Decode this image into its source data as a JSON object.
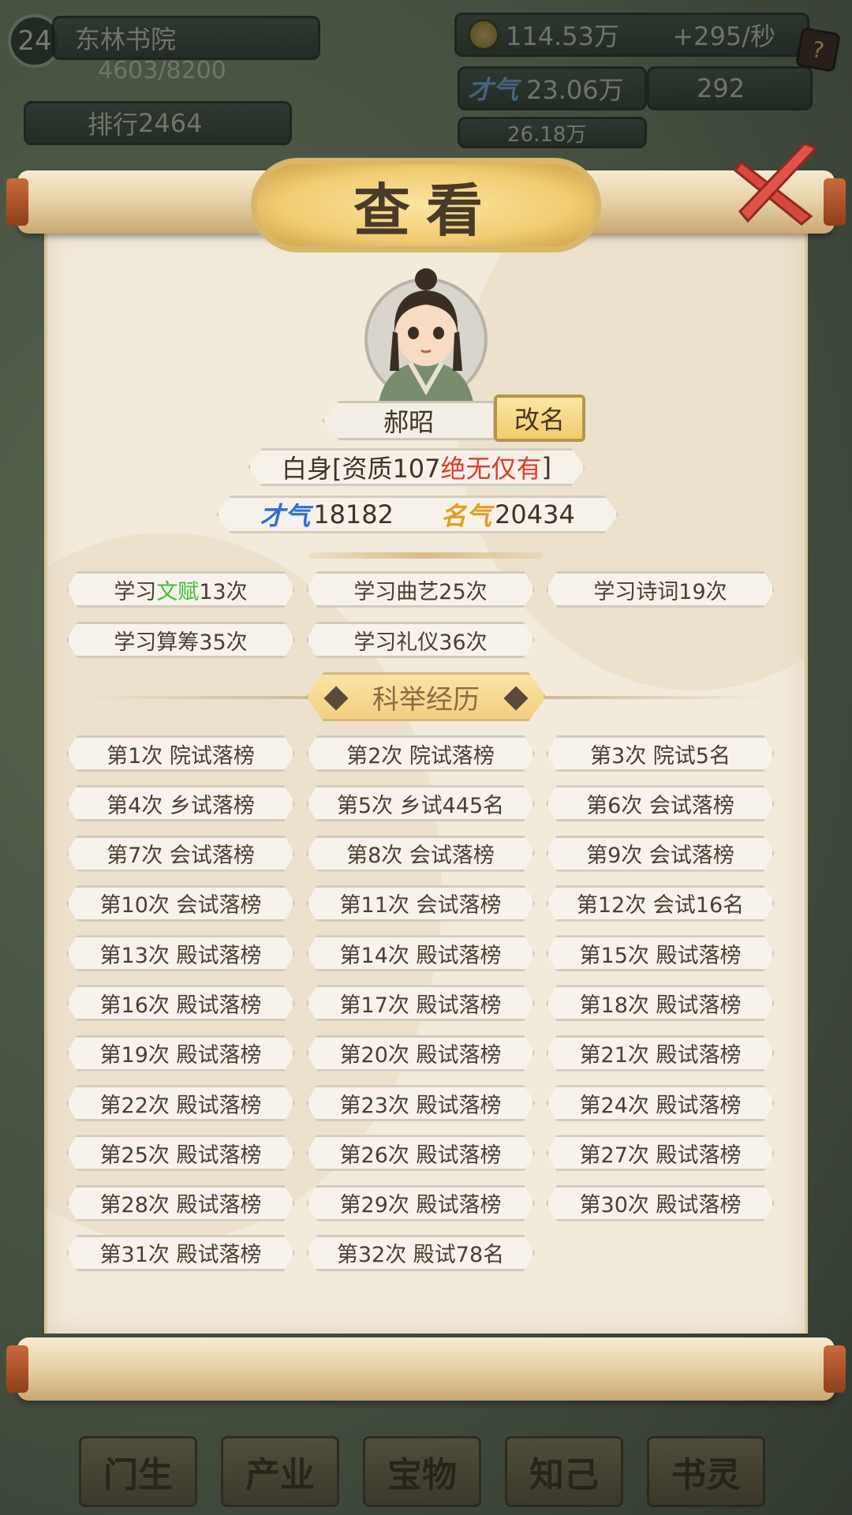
{
  "hud": {
    "level": "24",
    "school_name": "东林书院",
    "progress_text": "4603/8200",
    "rank_label": "排行",
    "rank_value": "2464",
    "coins": "114.53万",
    "coin_rate": "+295/秒",
    "talent_label": "才气",
    "talent_total": "23.06万",
    "item_count": "292",
    "fame_partial": "26.18万",
    "bottom_tabs": [
      "门生",
      "产业",
      "宝物",
      "知己",
      "书灵"
    ]
  },
  "dialog": {
    "title": "查看",
    "name": "郝昭",
    "rename_label": "改名",
    "status_prefix": "白身[资质107 ",
    "status_quality": "绝无仅有",
    "status_suffix": "]",
    "talent_label": "才气",
    "talent_value": "18182",
    "fame_label": "名气",
    "fame_value": "20434",
    "studies": [
      {
        "pre": "学习",
        "hl": "文赋",
        "post": "13次"
      },
      {
        "pre": "学习曲艺25次",
        "hl": "",
        "post": ""
      },
      {
        "pre": "学习诗词19次",
        "hl": "",
        "post": ""
      },
      {
        "pre": "学习算筹35次",
        "hl": "",
        "post": ""
      },
      {
        "pre": "学习礼仪36次",
        "hl": "",
        "post": ""
      }
    ],
    "exam_header": "科举经历",
    "exams": [
      "第1次 院试落榜",
      "第2次 院试落榜",
      "第3次 院试5名",
      "第4次 乡试落榜",
      "第5次 乡试445名",
      "第6次 会试落榜",
      "第7次 会试落榜",
      "第8次 会试落榜",
      "第9次 会试落榜",
      "第10次 会试落榜",
      "第11次 会试落榜",
      "第12次 会试16名",
      "第13次 殿试落榜",
      "第14次 殿试落榜",
      "第15次 殿试落榜",
      "第16次 殿试落榜",
      "第17次 殿试落榜",
      "第18次 殿试落榜",
      "第19次 殿试落榜",
      "第20次 殿试落榜",
      "第21次 殿试落榜",
      "第22次 殿试落榜",
      "第23次 殿试落榜",
      "第24次 殿试落榜",
      "第25次 殿试落榜",
      "第26次 殿试落榜",
      "第27次 殿试落榜",
      "第28次 殿试落榜",
      "第29次 殿试落榜",
      "第30次 殿试落榜",
      "第31次 殿试落榜",
      "第32次 殿试78名"
    ]
  },
  "colors": {
    "accent_gold": "#f0cc6d",
    "highlight_green": "#3fbf3a",
    "highlight_red": "#e23a2c",
    "talent_blue": "#2f6fd6",
    "fame_orange": "#e0a020"
  },
  "icons": [
    "coin-icon",
    "help-icon",
    "close-icon",
    "talent-icon",
    "fame-icon",
    "avatar"
  ]
}
